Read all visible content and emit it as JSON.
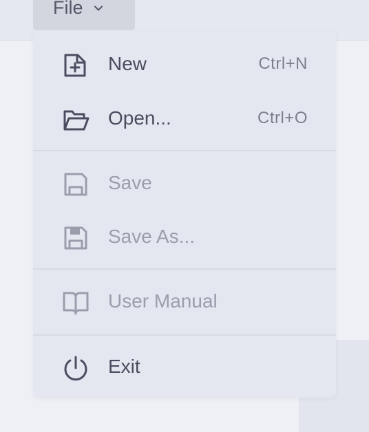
{
  "menubar": {
    "file_menu": {
      "label": "File",
      "chevron_icon": "chevron-down-icon"
    }
  },
  "file_menu": {
    "items": [
      {
        "label": "New",
        "shortcut": "Ctrl+N",
        "icon": "new-file-icon",
        "enabled": true
      },
      {
        "label": "Open...",
        "shortcut": "Ctrl+O",
        "icon": "open-folder-icon",
        "enabled": true
      },
      {
        "label": "Save",
        "shortcut": "",
        "icon": "save-icon",
        "enabled": false
      },
      {
        "label": "Save As...",
        "shortcut": "",
        "icon": "save-as-icon",
        "enabled": false
      },
      {
        "label": "User Manual",
        "shortcut": "",
        "icon": "book-icon",
        "enabled": false
      },
      {
        "label": "Exit",
        "shortcut": "",
        "icon": "power-icon",
        "enabled": true
      }
    ]
  },
  "colors": {
    "enabled_text": "#4b4c60",
    "disabled_text": "#9c9dac",
    "shortcut_text": "#7d7e8e",
    "menu_background": "#e5e7f0",
    "active_menu_button": "#d3d6df"
  }
}
